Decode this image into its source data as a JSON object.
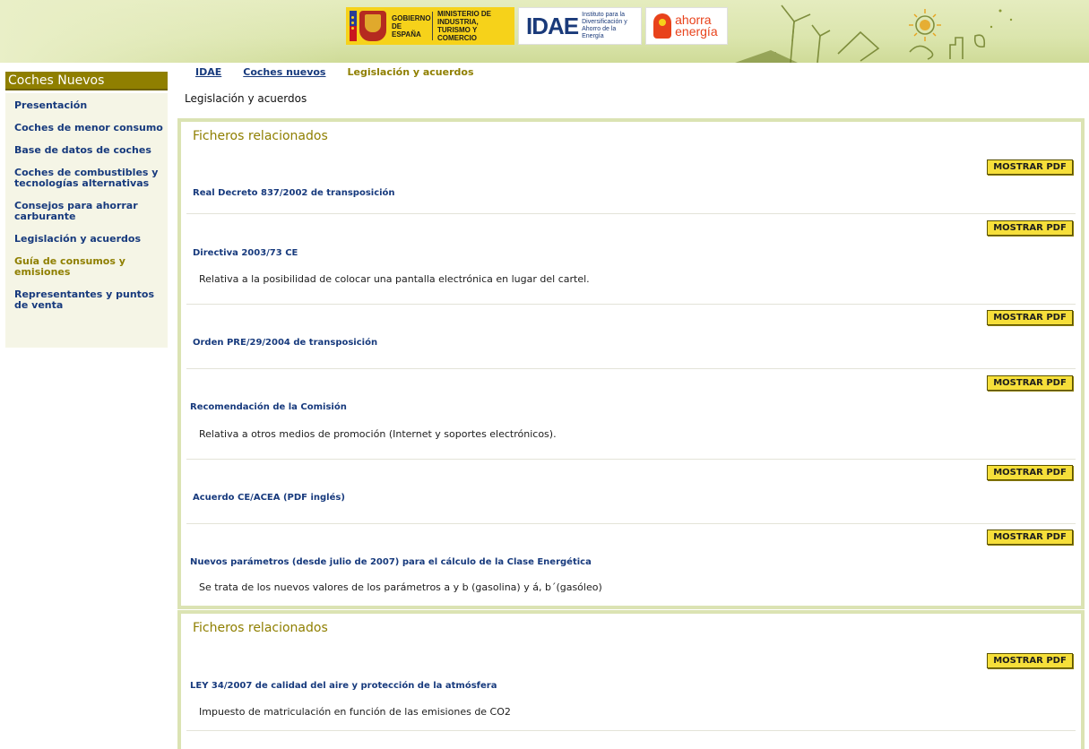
{
  "header": {
    "logos": {
      "gobierno": "GOBIERNO DE ESPAÑA",
      "ministerio": "MINISTERIO DE INDUSTRIA, TURISMO Y COMERCIO",
      "idae": "IDAE",
      "idae_sub": "Instituto para la Diversificación y Ahorro de la Energía",
      "ahorra_1": "ahorra",
      "ahorra_2": "energía"
    }
  },
  "sidebar": {
    "title": "Coches Nuevos",
    "items": [
      {
        "label": "Presentación"
      },
      {
        "label": "Coches de menor consumo"
      },
      {
        "label": "Base de datos de coches"
      },
      {
        "label": "Coches de combustibles y tecnologías alternativas"
      },
      {
        "label": "Consejos para ahorrar carburante"
      },
      {
        "label": "Legislación y acuerdos"
      },
      {
        "label": "Guía de consumos y emisiones"
      },
      {
        "label": "Representantes y puntos de venta"
      }
    ]
  },
  "breadcrumb": {
    "items": [
      {
        "label": "IDAE"
      },
      {
        "label": "Coches nuevos"
      }
    ],
    "current": "Legislación y acuerdos"
  },
  "page": {
    "title": "Legislación y acuerdos"
  },
  "panels": [
    {
      "title": "Ficheros relacionados",
      "button_label": "MOSTRAR PDF",
      "entries": [
        {
          "link": "Real Decreto 837/2002 de transposición",
          "desc": ""
        },
        {
          "link": "Directiva 2003/73 CE",
          "desc": "Relativa a la posibilidad de colocar una pantalla electrónica en lugar del cartel."
        },
        {
          "link": "Orden PRE/29/2004 de transposición",
          "desc": ""
        },
        {
          "link": "Recomendación de la Comisión",
          "desc": "Relativa a otros medios de promoción (Internet y soportes electrónicos)."
        },
        {
          "link": "Acuerdo CE/ACEA (PDF inglés)",
          "desc": ""
        },
        {
          "link": "Nuevos parámetros (desde julio de 2007) para el cálculo de la Clase Energética",
          "desc": "Se trata de los nuevos valores de los parámetros a y b (gasolina) y á, b´(gasóleo)"
        }
      ]
    },
    {
      "title": "Ficheros relacionados",
      "button_label": "MOSTRAR PDF",
      "entries": [
        {
          "link": "LEY 34/2007 de calidad del aire y protección de la atmósfera",
          "desc": "Impuesto de matriculación en función de las emisiones de CO2"
        }
      ]
    }
  ]
}
